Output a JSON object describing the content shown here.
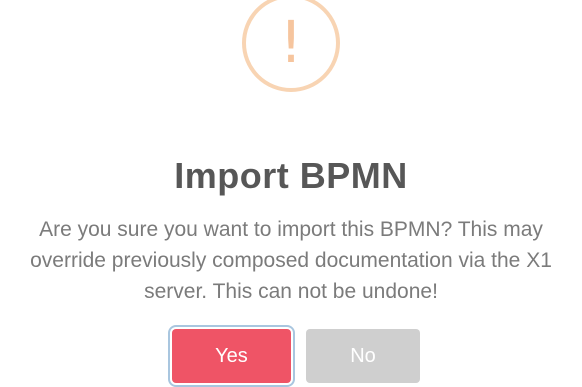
{
  "dialog": {
    "icon": "warning-exclamation-icon",
    "icon_glyph": "!",
    "title": "Import BPMN",
    "message_lines": [
      "Are you sure you want to import this BPMN? This may",
      "override previously composed documentation via the X1",
      "server. This can not be undone!"
    ],
    "confirm_label": "Yes",
    "cancel_label": "No"
  },
  "colors": {
    "confirm": "#ef5466",
    "cancel": "#cfcfcf",
    "warning_ring": "#f8d4b3",
    "warning_mark": "#f6c59e",
    "title_text": "#575757",
    "message_text": "#7b7b7b"
  }
}
